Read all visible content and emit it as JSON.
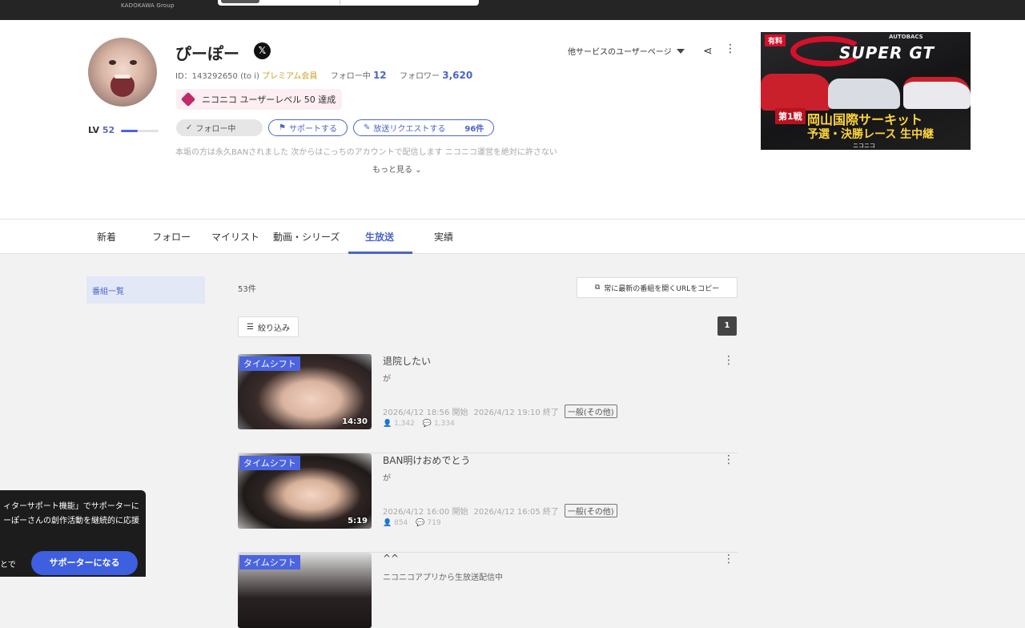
{
  "topbar": {
    "brand_sub": "KADOKAWA Group"
  },
  "profile": {
    "name": "ぴーぽー",
    "x_icon": "x-logo-icon",
    "id_text": "ID：143292650 (to i)",
    "premium": "プレミアム会員",
    "following_label": "フォロー中",
    "following_count": "12",
    "followers_label": "フォロワー",
    "followers_count": "3,620",
    "level_label": "LV",
    "level": "52",
    "level_progress": 0.45,
    "achievement": "ニコニコ ユーザーレベル 50 達成",
    "follow_button": "フォロー中",
    "support_button": "サポートする",
    "request_button": "放送リクエストする",
    "request_count": "96件",
    "description": "本垢の方は永久BANされました 次からはこっちのアカウントで配信します ニコニコ運営を絶対に許さない",
    "more": "もっと見る",
    "other_services": "他サービスのユーザーページ"
  },
  "ad": {
    "paid": "有料",
    "brand": "AUTOBACS",
    "title": "SUPER GT",
    "round": "第1戦",
    "circuit": "岡山国際サーキット",
    "race": "予選・決勝レース 生中継",
    "provider": "ニコニコ"
  },
  "tabs": [
    "新着",
    "フォロー",
    "マイリスト",
    "動画・シリーズ",
    "生放送",
    "実績"
  ],
  "active_tab": "生放送",
  "sidebar": {
    "item": "番組一覧"
  },
  "list": {
    "count": "53件",
    "copy_url": "常に最新の番組を開くURLをコピー",
    "filter": "絞り込み",
    "page": "1",
    "items": [
      {
        "badge": "タイムシフト",
        "duration": "14:30",
        "title": "退院したい",
        "desc": "が",
        "start": "2026/4/12 18:56 開始",
        "end": "2026/4/12 19:10 終了",
        "category": "一般(その他)",
        "views": "1,342",
        "comments": "1,334"
      },
      {
        "badge": "タイムシフト",
        "duration": "5:19",
        "title": "BAN明けおめでとう",
        "desc": "が",
        "start": "2026/4/12 16:00 開始",
        "end": "2026/4/12 16:05 終了",
        "category": "一般(その他)",
        "views": "854",
        "comments": "719"
      },
      {
        "badge": "タイムシフト",
        "title": "^^",
        "desc": "ニコニコアプリから生放送配信中"
      }
    ]
  },
  "popup": {
    "line1": "ィターサポート機能」でサポーターに",
    "line2": "ーぽーさんの創作活動を継続的に応援",
    "line3": "とで",
    "button": "サポーターになる"
  }
}
